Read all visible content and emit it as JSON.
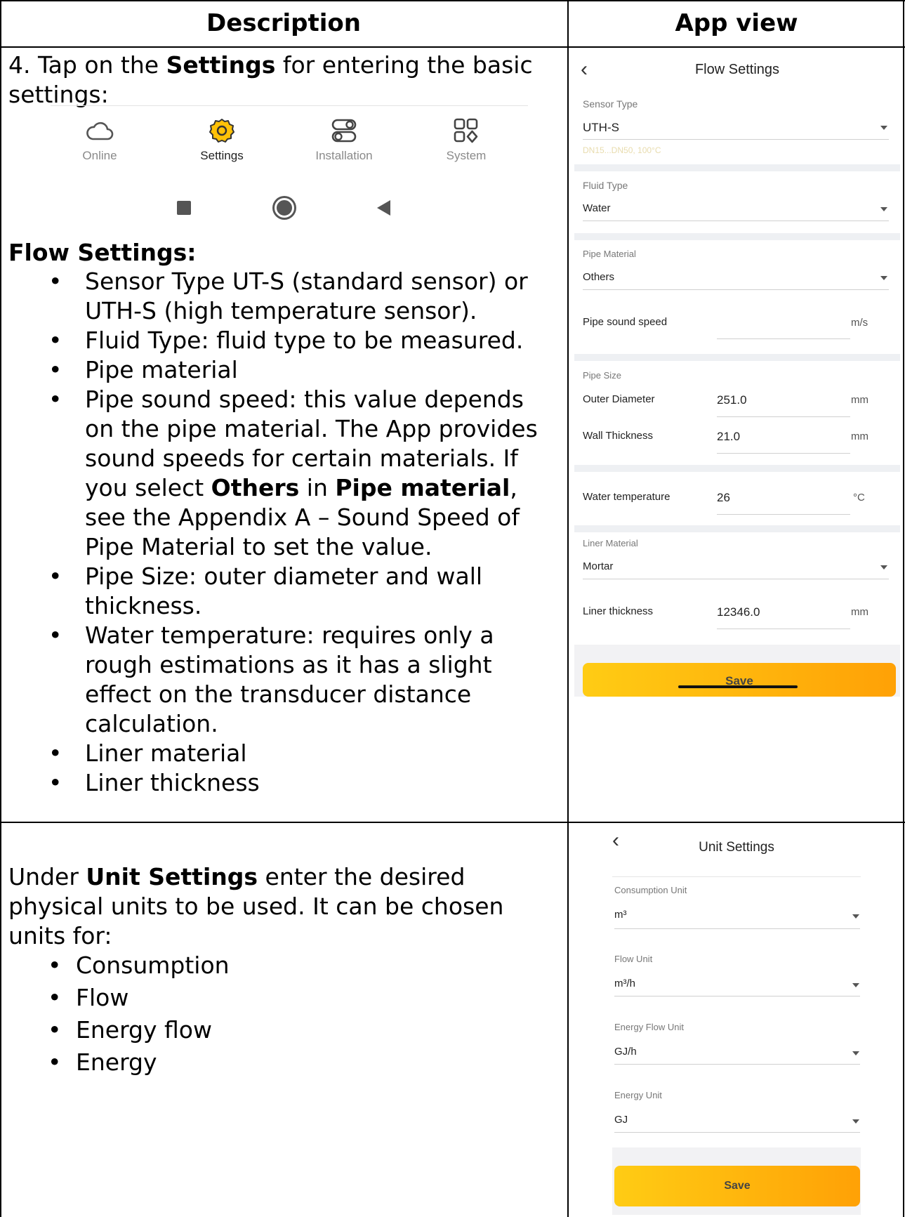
{
  "header": {
    "col1": "Description",
    "col2": "App view"
  },
  "step4": {
    "prefix": "4. Tap on the ",
    "bold": "Settings",
    "suffix": " for entering the basic",
    "line2": "settings:"
  },
  "nav": {
    "items": [
      {
        "label": "Online",
        "icon": "cloud-icon"
      },
      {
        "label": "Settings",
        "icon": "gear-icon"
      },
      {
        "label": "Installation",
        "icon": "toggles-icon"
      },
      {
        "label": "System",
        "icon": "grid-icon"
      }
    ],
    "system_buttons": [
      "square-icon",
      "circle-icon",
      "back-triangle-icon"
    ]
  },
  "flow_section": {
    "title": "Flow Settings:",
    "bullets": {
      "b1_l1": "Sensor Type UT-S (standard sensor) or",
      "b1_l2": "UTH-S (high temperature sensor).",
      "b2": "Fluid Type: fluid type to be measured.",
      "b3": "Pipe material",
      "b4_l1": "Pipe sound speed: this value depends",
      "b4_l2": "on the pipe material. The App provides",
      "b4_l3": "sound speeds for certain materials. If",
      "b4_l4_a": "you select ",
      "b4_l4_b": "Others",
      "b4_l4_c": " in ",
      "b4_l4_d": "Pipe material",
      "b4_l4_e": ",",
      "b4_l5": "see the Appendix A – Sound Speed of",
      "b4_l6": "Pipe Material to set the value.",
      "b5_l1": "Pipe Size: outer diameter and wall",
      "b5_l2": "thickness.",
      "b6_l1": "Water temperature: requires only a",
      "b6_l2": "rough estimations as it has a slight",
      "b6_l3": "effect on the transducer distance",
      "b6_l4": "calculation.",
      "b7": "Liner material",
      "b8": "Liner thickness"
    }
  },
  "flow_app": {
    "title": "Flow Settings",
    "sensor_type_label": "Sensor Type",
    "sensor_type_value": "UTH-S",
    "sensor_type_hint": "DN15...DN50, 100°C",
    "fluid_type_label": "Fluid Type",
    "fluid_type_value": "Water",
    "pipe_material_label": "Pipe Material",
    "pipe_material_value": "Others",
    "pipe_sound_speed_label": "Pipe sound speed",
    "pipe_sound_speed_unit": "m/s",
    "pipe_size_label": "Pipe Size",
    "outer_diameter_label": "Outer Diameter",
    "outer_diameter_value": "251.0",
    "outer_diameter_unit": "mm",
    "wall_thickness_label": "Wall Thickness",
    "wall_thickness_value": "21.0",
    "wall_thickness_unit": "mm",
    "water_temp_label": "Water temperature",
    "water_temp_value": "26",
    "water_temp_unit": "°C",
    "liner_material_label": "Liner Material",
    "liner_material_value": "Mortar",
    "liner_thickness_label": "Liner thickness",
    "liner_thickness_value": "12346.0",
    "liner_thickness_unit": "mm",
    "save": "Save"
  },
  "unit_section": {
    "intro_a": "Under ",
    "intro_b": "Unit Settings",
    "intro_c": " enter the desired",
    "line2": "physical units to be used. It can be chosen",
    "line3": "units for:",
    "bullets": [
      "Consumption",
      "Flow",
      "Energy flow",
      "Energy"
    ]
  },
  "unit_app": {
    "title": "Unit Settings",
    "consumption_label": "Consumption Unit",
    "consumption_value": "m³",
    "flow_label": "Flow Unit",
    "flow_value": "m³/h",
    "energy_flow_label": "Energy Flow Unit",
    "energy_flow_value": "GJ/h",
    "energy_label": "Energy Unit",
    "energy_value": "GJ",
    "save": "Save"
  }
}
